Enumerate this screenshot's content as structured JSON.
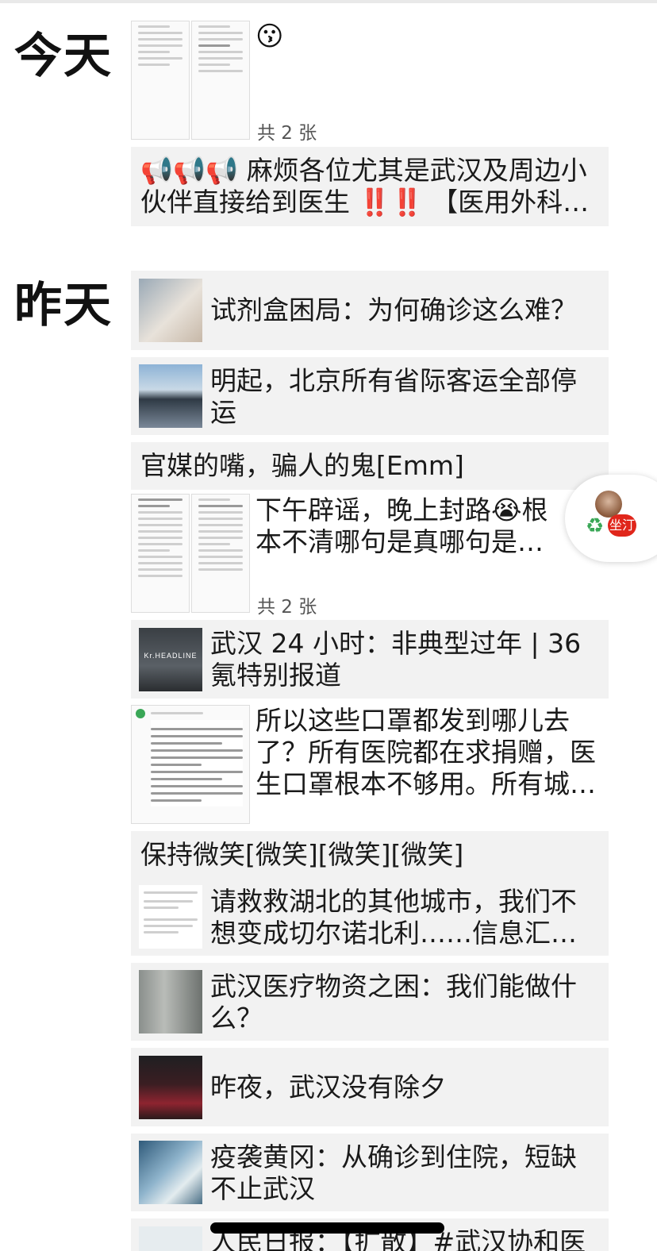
{
  "sections": {
    "today": "今天",
    "yesterday": "昨天"
  },
  "today": {
    "photo_post": {
      "emoji": "😗",
      "count": "共 2 张"
    },
    "text_share": {
      "text": "📢📢📢 麻烦各位尤其是武汉及周边小伙伴直接给到医生 ‼️‼️ 【医用外科…"
    }
  },
  "yesterday": {
    "items": [
      {
        "title": "试剂盒困局：为何确诊这么难？"
      },
      {
        "title": "明起，北京所有省际客运全部停运"
      },
      {
        "header": "官媒的嘴，骗人的鬼[Emm]"
      },
      {
        "text": "下午辟谣，晚上封路😭根本不清哪句是真哪句是假。",
        "count": "共 2 张"
      },
      {
        "title": "武汉 24 小时：非典型过年 | 36 氪特别报道",
        "thumb_label": "Kr.HEADLINE"
      },
      {
        "text": "所以这些口罩都发到哪儿去了？所有医院都在求捐赠，医生口罩根本不够用。所有城…"
      },
      {
        "header": "保持微笑[微笑][微笑][微笑]"
      },
      {
        "title": "请救救湖北的其他城市，我们不想变成切尔诺北利……信息汇总…"
      },
      {
        "title": "武汉医疗物资之困：我们能做什么？"
      },
      {
        "title": "昨夜，武汉没有除夕"
      },
      {
        "title": "疫袭黄冈：从确诊到住院，短缺不止武汉"
      },
      {
        "title": "人民日报：【扩散】#武汉协和医"
      }
    ]
  },
  "floating_button": {
    "label": "坐汀"
  },
  "colors": {
    "card_bg": "#f2f2f2",
    "red": "#e0261b",
    "accent_green": "#3aa757"
  }
}
